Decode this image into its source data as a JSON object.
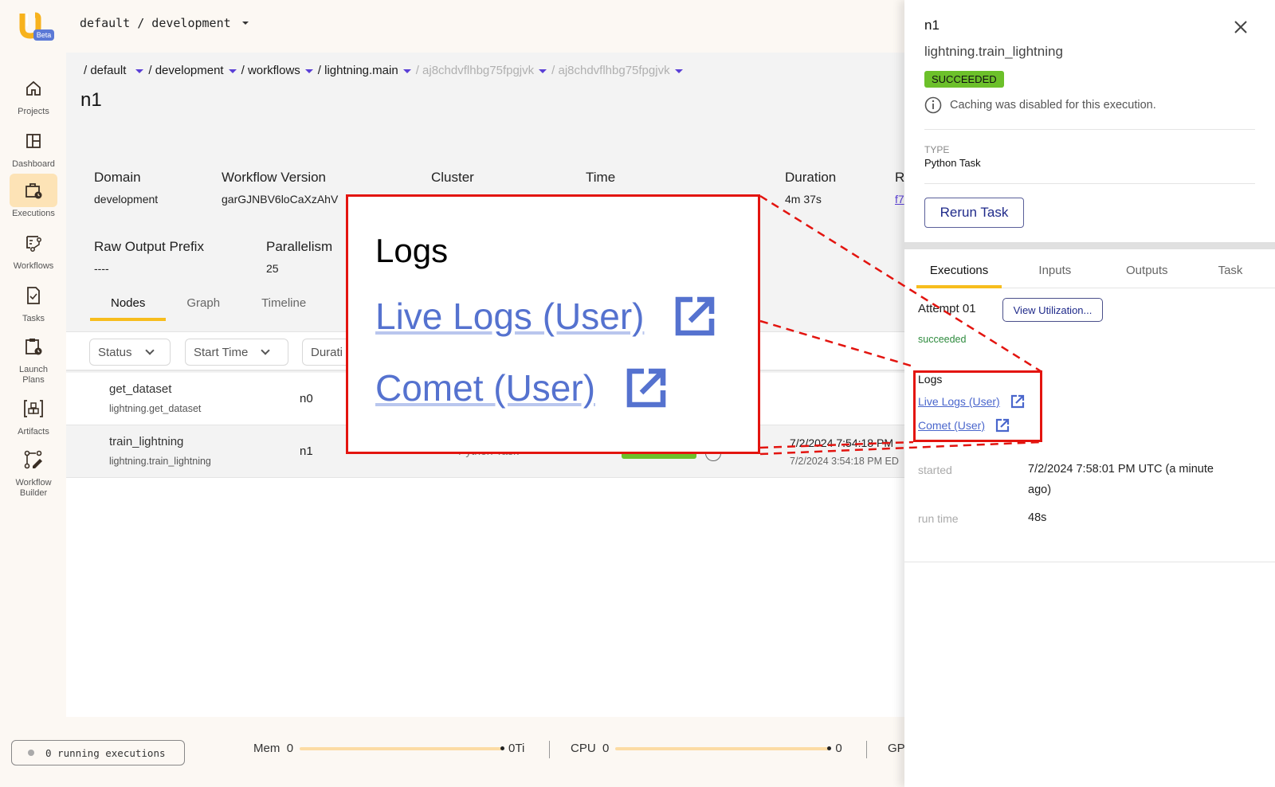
{
  "header": {
    "logo_badge": "Beta",
    "org_path": "default / development"
  },
  "sidebar": {
    "items": [
      {
        "label": "Projects",
        "icon": "home-icon"
      },
      {
        "label": "Dashboard",
        "icon": "dashboard-icon"
      },
      {
        "label": "Executions",
        "icon": "executions-icon",
        "active": true
      },
      {
        "label": "Workflows",
        "icon": "workflows-icon"
      },
      {
        "label": "Tasks",
        "icon": "tasks-icon"
      },
      {
        "label": "Launch Plans",
        "icon": "launch-plans-icon"
      },
      {
        "label": "Artifacts",
        "icon": "artifacts-icon"
      },
      {
        "label": "Workflow Builder",
        "icon": "workflow-builder-icon"
      }
    ]
  },
  "breadcrumb": [
    {
      "label": "/ default"
    },
    {
      "label": "/ development"
    },
    {
      "label": "/ workflows"
    },
    {
      "label": "/ lightning.main"
    },
    {
      "label": "/ aj8chdvflhbg75fpgjvk",
      "muted": true
    },
    {
      "label": "/ aj8chdvflhbg75fpgjvk",
      "muted": true
    }
  ],
  "page": {
    "title": "n1"
  },
  "meta": {
    "domain_label": "Domain",
    "domain_value": "development",
    "workflow_version_label": "Workflow Version",
    "workflow_version_value": "garGJNBV6loCaXzAhV",
    "cluster_label": "Cluster",
    "time_label": "Time",
    "duration_label": "Duration",
    "duration_value": "4m 37s",
    "related_label": "R",
    "related_value": "f7",
    "raw_output_label": "Raw Output Prefix",
    "raw_output_value": "----",
    "parallelism_label": "Parallelism",
    "parallelism_value": "25"
  },
  "tabs": [
    {
      "label": "Nodes",
      "active": true
    },
    {
      "label": "Graph"
    },
    {
      "label": "Timeline"
    }
  ],
  "filters": [
    {
      "label": "Status"
    },
    {
      "label": "Start Time"
    },
    {
      "label": "Durati"
    }
  ],
  "nodes": [
    {
      "name": "get_dataset",
      "task": "lightning.get_dataset",
      "id": "n0",
      "type": "",
      "time_utc": "",
      "time_local": ""
    },
    {
      "name": "train_lightning",
      "task": "lightning.train_lightning",
      "id": "n1",
      "type": "Python Task",
      "time_utc": "7/2/2024 7:54:18 PM",
      "time_local": "7/2/2024 3:54:18 PM ED"
    }
  ],
  "footer": {
    "running": "0 running executions",
    "mem_label": "Mem",
    "mem_min": "0",
    "mem_max": "0Ti",
    "mem_usage": 0,
    "cpu_label": "CPU",
    "cpu_min": "0",
    "cpu_max": "0",
    "cpu_usage": 0,
    "gpu_label": "GP"
  },
  "panel": {
    "title": "n1",
    "subtitle": "lightning.train_lightning",
    "status": "SUCCEEDED",
    "caching_note": "Caching was disabled for this execution.",
    "type_label": "TYPE",
    "type_value": "Python Task",
    "rerun_label": "Rerun Task",
    "tabs": [
      {
        "label": "Executions",
        "active": true
      },
      {
        "label": "Inputs"
      },
      {
        "label": "Outputs"
      },
      {
        "label": "Task"
      }
    ],
    "attempt_label": "Attempt 01",
    "view_util_label": "View Utilization...",
    "attempt_status": "succeeded",
    "logs_heading": "Logs",
    "logs": [
      {
        "label": "Live Logs (User)"
      },
      {
        "label": "Comet (User)"
      }
    ],
    "started_label": "started",
    "started_value": "7/2/2024 7:58:01 PM UTC (a minute ago)",
    "runtime_label": "run time",
    "runtime_value": "48s"
  },
  "callout": {
    "heading": "Logs",
    "links": [
      {
        "label": "Live Logs (User)"
      },
      {
        "label": "Comet (User)"
      }
    ]
  },
  "colors": {
    "accent": "#f7bd1d",
    "success": "#6cc02a",
    "link": "#4a66cc",
    "annotation": "#e3140f",
    "breadcrumb_caret": "#5a3fd6"
  }
}
